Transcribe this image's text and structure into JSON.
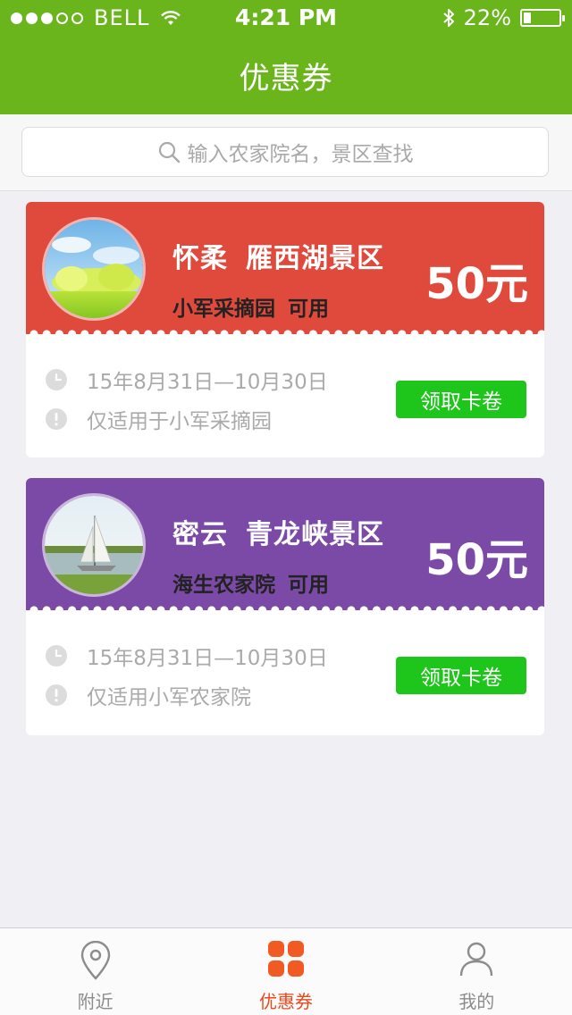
{
  "status_bar": {
    "carrier": "BELL",
    "time": "4:21 PM",
    "battery": "22%",
    "battery_level": 0.22,
    "signal_dots_on": 3,
    "signal_dots_total": 5
  },
  "nav": {
    "title": "优惠券"
  },
  "search": {
    "placeholder": "输入农家院名，景区查找"
  },
  "coupons": [
    {
      "area": "怀柔",
      "scenic": "雁西湖景区",
      "venue": "小军采摘园",
      "usable": "可用",
      "amount": "50元",
      "date_range": "15年8月31日—10月30日",
      "scope": "仅适用于小军采摘园",
      "claim_label": "领取卡卷",
      "color": "#df4a3c"
    },
    {
      "area": "密云",
      "scenic": "青龙峡景区",
      "venue": "海生农家院",
      "usable": "可用",
      "amount": "50元",
      "date_range": "15年8月31日—10月30日",
      "scope": "仅适用小军农家院",
      "claim_label": "领取卡卷",
      "color": "#7a4aa6"
    }
  ],
  "tabbar": {
    "items": [
      {
        "label": "附近",
        "icon": "location-pin-icon",
        "active": false
      },
      {
        "label": "优惠券",
        "icon": "four-petal-grid-icon",
        "active": true
      },
      {
        "label": "我的",
        "icon": "user-icon",
        "active": false
      }
    ],
    "active_color": "#e84a1f"
  },
  "colors": {
    "nav_green": "#6ab41c",
    "claim_green": "#1ec61b"
  }
}
